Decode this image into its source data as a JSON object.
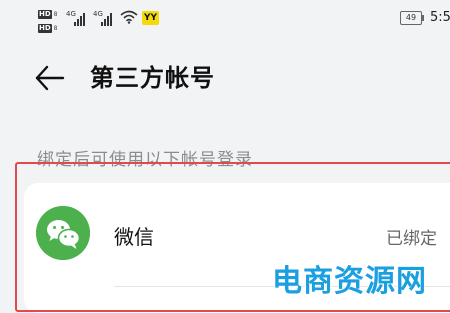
{
  "status_bar": {
    "hd_label": "HD",
    "hd_sub": "8",
    "signal_gen_1": "4G",
    "signal_gen_2": "4G",
    "app_badge": "YY",
    "battery_level": "49",
    "time": "5:5"
  },
  "header": {
    "back_icon": "arrow-left-icon",
    "title": "第三方帐号"
  },
  "section": {
    "caption": "绑定后可使用以下帐号登录"
  },
  "accounts": [
    {
      "icon": "wechat-icon",
      "icon_color": "#4cb14d",
      "label": "微信",
      "status": "已绑定"
    }
  ],
  "highlight_color": "#e0494d",
  "watermark": {
    "text": "电商资源网",
    "color": "#1a9fe0"
  }
}
